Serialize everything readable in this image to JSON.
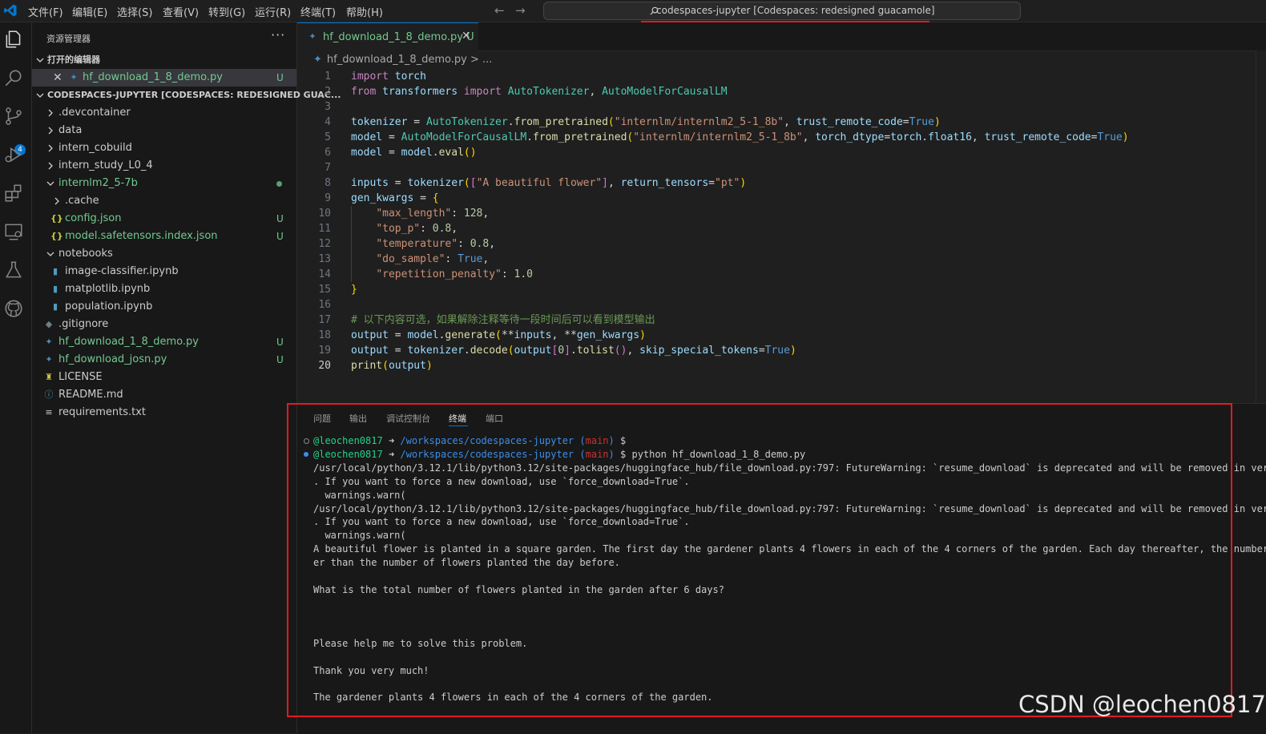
{
  "menu": [
    "文件(F)",
    "编辑(E)",
    "选择(S)",
    "查看(V)",
    "转到(G)",
    "运行(R)",
    "终端(T)",
    "帮助(H)"
  ],
  "command_center": "codespaces-jupyter [Codespaces: redesigned guacamole]",
  "activity": {
    "scm_badge": "4"
  },
  "sidebar": {
    "title": "资源管理器",
    "more": "···",
    "open_editors_label": "打开的编辑器",
    "open_editor": {
      "name": "hf_download_1_8_demo.py",
      "status": "U"
    },
    "workspace_label": "CODESPACES-JUPYTER [CODESPACES: REDESIGNED GUAC...",
    "tree": [
      {
        "name": ".devcontainer",
        "status": ""
      },
      {
        "name": "data",
        "status": ""
      },
      {
        "name": "intern_cobuild",
        "status": ""
      },
      {
        "name": "intern_study_L0_4",
        "status": ""
      },
      {
        "name": "internlm2_5-7b",
        "status": ""
      },
      {
        "name": ".cache",
        "status": ""
      },
      {
        "name": "config.json",
        "status": "U"
      },
      {
        "name": "model.safetensors.index.json",
        "status": "U"
      },
      {
        "name": "notebooks",
        "status": ""
      },
      {
        "name": "image-classifier.ipynb",
        "status": ""
      },
      {
        "name": "matplotlib.ipynb",
        "status": ""
      },
      {
        "name": "population.ipynb",
        "status": ""
      },
      {
        "name": ".gitignore",
        "status": ""
      },
      {
        "name": "hf_download_1_8_demo.py",
        "status": "U"
      },
      {
        "name": "hf_download_josn.py",
        "status": "U"
      },
      {
        "name": "LICENSE",
        "status": ""
      },
      {
        "name": "README.md",
        "status": ""
      },
      {
        "name": "requirements.txt",
        "status": ""
      }
    ]
  },
  "editor": {
    "tab_label": "hf_download_1_8_demo.py",
    "tab_status": "U",
    "breadcrumb": "hf_download_1_8_demo.py > ...",
    "line_numbers": [
      "1",
      "2",
      "3",
      "4",
      "5",
      "6",
      "7",
      "8",
      "9",
      "10",
      "11",
      "12",
      "13",
      "14",
      "15",
      "16",
      "17",
      "18",
      "19",
      "20"
    ],
    "lines": [
      "import torch",
      "from transformers import AutoTokenizer, AutoModelForCausalLM",
      "",
      "tokenizer = AutoTokenizer.from_pretrained(\"internlm/internlm2_5-1_8b\", trust_remote_code=True)",
      "model = AutoModelForCausalLM.from_pretrained(\"internlm/internlm2_5-1_8b\", torch_dtype=torch.float16, trust_remote_code=True)",
      "model = model.eval()",
      "",
      "inputs = tokenizer([\"A beautiful flower\"], return_tensors=\"pt\")",
      "gen_kwargs = {",
      "    \"max_length\": 128,",
      "    \"top_p\": 0.8,",
      "    \"temperature\": 0.8,",
      "    \"do_sample\": True,",
      "    \"repetition_penalty\": 1.0",
      "}",
      "",
      "# 以下内容可选，如果解除注释等待一段时间后可以看到模型输出",
      "output = model.generate(**inputs, **gen_kwargs)",
      "output = tokenizer.decode(output[0].tolist(), skip_special_tokens=True)",
      "print(output)"
    ]
  },
  "panel": {
    "tabs": [
      "问题",
      "输出",
      "调试控制台",
      "终端",
      "端口"
    ],
    "prompt_user": "@leochen0817",
    "prompt_arrow": "➜",
    "prompt_path": "/workspaces/codespaces-jupyter",
    "prompt_branch_open": "(",
    "prompt_branch": "main",
    "prompt_branch_close": ")",
    "prompt_dollar": "$",
    "command": "python hf_download_1_8_demo.py",
    "output": [
      "/usr/local/python/3.12.1/lib/python3.12/site-packages/huggingface_hub/file_download.py:797: FutureWarning: `resume_download` is deprecated and will be removed in version",
      ". If you want to force a new download, use `force_download=True`.",
      "  warnings.warn(",
      "/usr/local/python/3.12.1/lib/python3.12/site-packages/huggingface_hub/file_download.py:797: FutureWarning: `resume_download` is deprecated and will be removed in version",
      ". If you want to force a new download, use `force_download=True`.",
      "  warnings.warn(",
      "A beautiful flower is planted in a square garden. The first day the gardener plants 4 flowers in each of the 4 corners of the garden. Each day thereafter, the number of f",
      "er than the number of flowers planted the day before.",
      "",
      "What is the total number of flowers planted in the garden after 6 days?",
      "",
      "",
      "",
      "Please help me to solve this problem.",
      "",
      "Thank you very much!",
      "",
      "The gardener plants 4 flowers in each of the 4 corners of the garden."
    ]
  },
  "watermark": "CSDN @leochen0817"
}
